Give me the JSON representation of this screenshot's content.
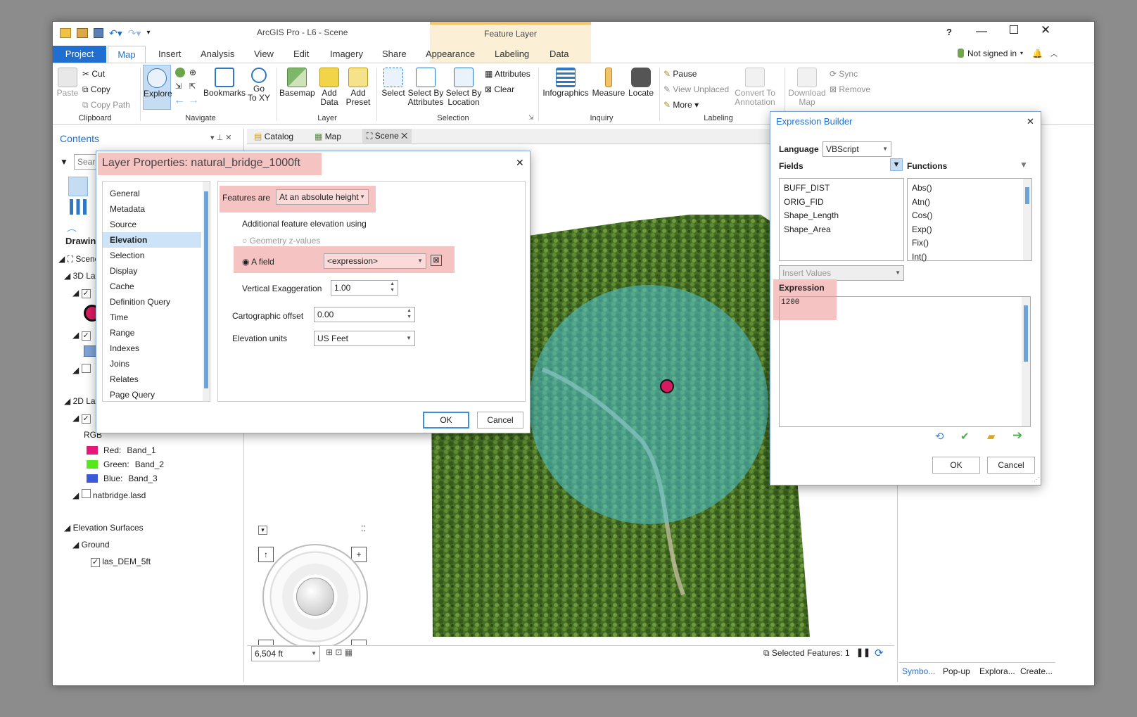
{
  "app": {
    "title": "ArcGIS Pro - L6 - Scene",
    "context_tab": "Feature Layer",
    "help": "?",
    "account": "Not signed in",
    "tabs": [
      "Project",
      "Map",
      "Insert",
      "Analysis",
      "View",
      "Edit",
      "Imagery",
      "Share",
      "Appearance",
      "Labeling",
      "Data"
    ]
  },
  "ribbon": {
    "clipboard": {
      "group": "Clipboard",
      "paste": "Paste",
      "cut": "Cut",
      "copy": "Copy",
      "copy_path": "Copy Path"
    },
    "navigate": {
      "group": "Navigate",
      "explore": "Explore",
      "bookmarks": "Bookmarks",
      "goto_1": "Go",
      "goto_2": "To XY"
    },
    "layer": {
      "group": "Layer",
      "basemap": "Basemap",
      "add_data_1": "Add",
      "add_data_2": "Data",
      "add_preset_1": "Add",
      "add_preset_2": "Preset"
    },
    "selection": {
      "group": "Selection",
      "select": "Select",
      "sba_1": "Select By",
      "sba_2": "Attributes",
      "sbl_1": "Select By",
      "sbl_2": "Location",
      "attributes": "Attributes",
      "clear": "Clear"
    },
    "inquiry": {
      "group": "Inquiry",
      "infographics": "Infographics",
      "measure": "Measure",
      "locate": "Locate"
    },
    "labeling": {
      "group": "Labeling",
      "pause": "Pause",
      "view_unplaced": "View Unplaced",
      "more": "More",
      "convert_1": "Convert To",
      "convert_2": "Annotation"
    },
    "offline": {
      "download_1": "Download",
      "download_2": "Map",
      "sync": "Sync",
      "remove": "Remove"
    }
  },
  "contents": {
    "title": "Contents",
    "search_placeholder": "Search",
    "drawing_order": "Drawing Order",
    "scene": "Scene",
    "layers_3d": "3D Layers",
    "layers_2d": "2D Layers",
    "rgb": "RGB",
    "red": "Red:",
    "red_band": "Band_1",
    "green": "Green:",
    "green_band": "Band_2",
    "blue": "Blue:",
    "blue_band": "Band_3",
    "natbridge": "natbridge.lasd",
    "elev_surfaces": "Elevation Surfaces",
    "ground": "Ground",
    "las_dem": "las_DEM_5ft"
  },
  "view_tabs": [
    "Catalog",
    "Map",
    "Scene"
  ],
  "status": {
    "scale": "6,504 ft",
    "selected": "Selected Features: 1"
  },
  "right_tabs": [
    "Symbo...",
    "Pop-up",
    "Explora...",
    "Create..."
  ],
  "layer_props": {
    "title": "Layer Properties: natural_bridge_1000ft",
    "nav": [
      "General",
      "Metadata",
      "Source",
      "Elevation",
      "Selection",
      "Display",
      "Cache",
      "Definition Query",
      "Time",
      "Range",
      "Indexes",
      "Joins",
      "Relates",
      "Page Query"
    ],
    "features_are_label": "Features are",
    "features_are_value": "At an absolute height",
    "additional_label": "Additional feature elevation using",
    "geom_z": "Geometry z-values",
    "a_field": "A field",
    "field_value": "<expression>",
    "vert_exag_label": "Vertical Exaggeration",
    "vert_exag_value": "1.00",
    "carto_offset_label": "Cartographic offset",
    "carto_offset_value": "0.00",
    "elev_units_label": "Elevation units",
    "elev_units_value": "US Feet",
    "ok": "OK",
    "cancel": "Cancel"
  },
  "expr_builder": {
    "title": "Expression Builder",
    "language_label": "Language",
    "language_value": "VBScript",
    "fields_label": "Fields",
    "functions_label": "Functions",
    "fields": [
      "BUFF_DIST",
      "ORIG_FID",
      "Shape_Length",
      "Shape_Area"
    ],
    "functions": [
      "Abs()",
      "Atn()",
      "Cos()",
      "Exp()",
      "Fix()",
      "Int()"
    ],
    "insert_values": "Insert Values",
    "expression_label": "Expression",
    "expression_value": "1200",
    "ok": "OK",
    "cancel": "Cancel"
  },
  "colors": {
    "accent": "#1f6fd1",
    "highlight": "#f6c3c3",
    "buffer": "#4fc3d6",
    "point": "#d81b60"
  }
}
